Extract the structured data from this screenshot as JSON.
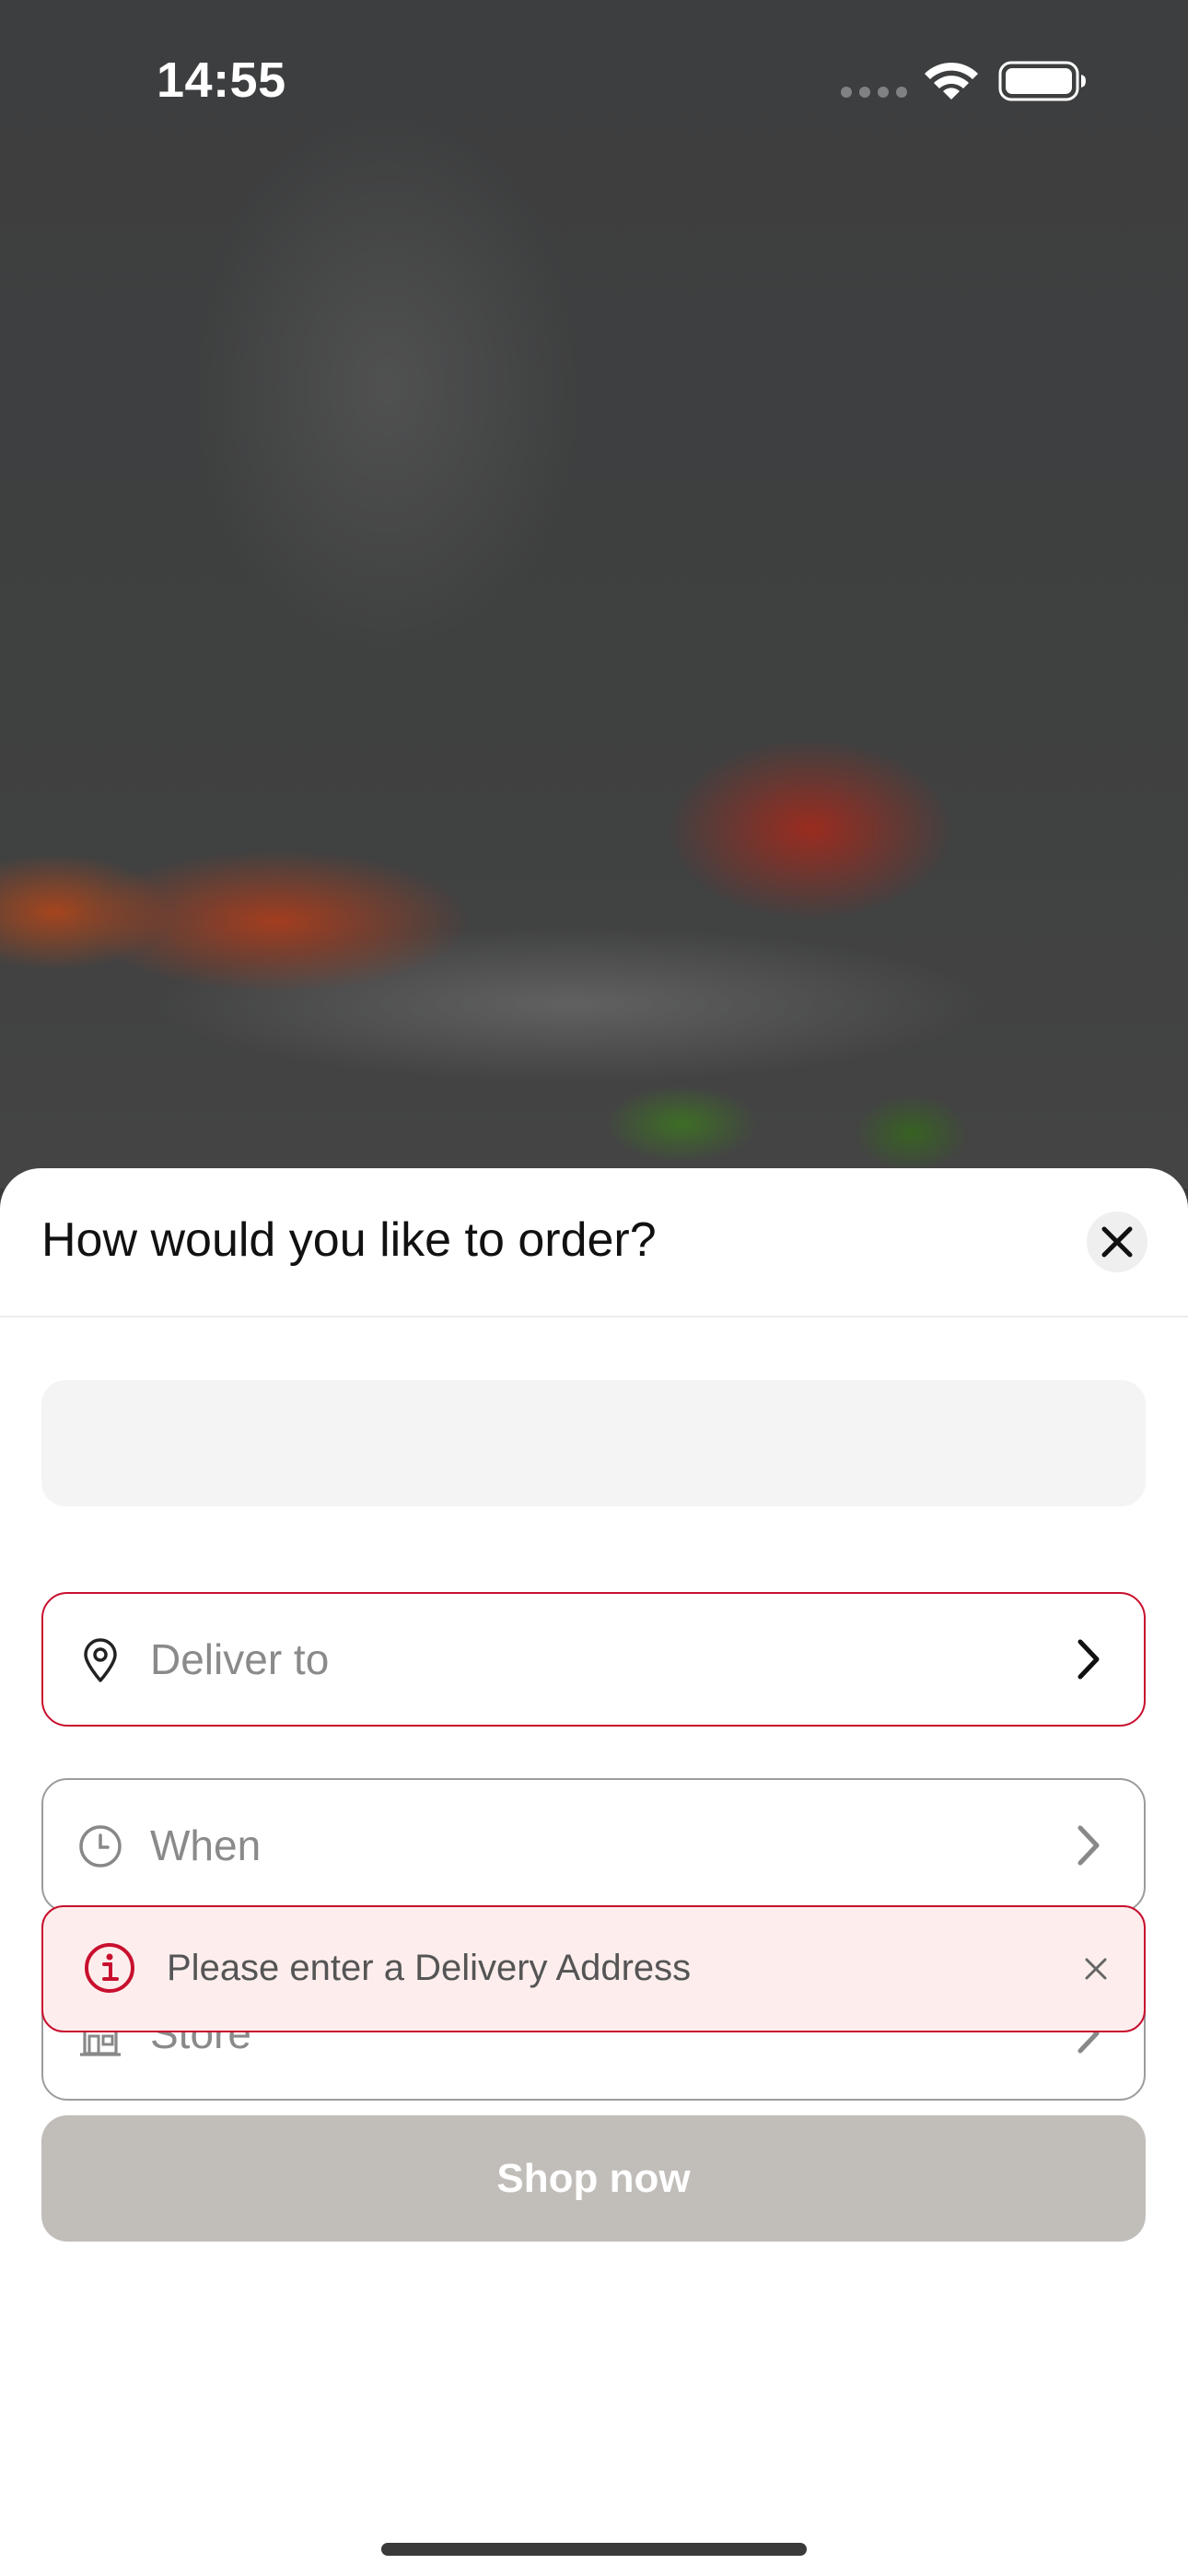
{
  "status_bar": {
    "time": "14:55",
    "icons": [
      "signal-dots-icon",
      "wifi-icon",
      "battery-icon"
    ]
  },
  "sheet": {
    "title": "How would you like to order?",
    "close_icon": "close-icon",
    "fields": [
      {
        "label": "Deliver to",
        "icon": "location-pin-icon",
        "state": "error"
      },
      {
        "label": "When",
        "icon": "clock-icon",
        "state": "normal"
      },
      {
        "label": "Store",
        "icon": "store-icon",
        "state": "normal"
      }
    ],
    "alert": {
      "message": "Please enter a Delivery Address",
      "icon": "info-icon",
      "dismiss_icon": "close-icon"
    },
    "primary_button": {
      "label": "Shop now",
      "enabled": false
    }
  },
  "colors": {
    "error": "#c8102e",
    "alert_background": "#fdeeed",
    "disabled_button": "#c1bdb9",
    "field_border": "#9c9c9c"
  }
}
